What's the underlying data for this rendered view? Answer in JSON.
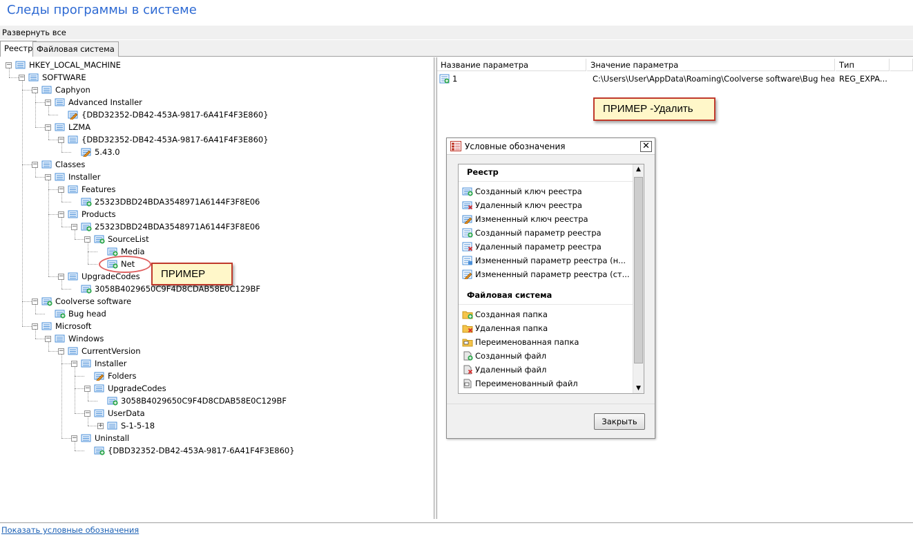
{
  "app": {
    "title": "Следы программы в системе",
    "menu": "Развернуть все",
    "tabs": [
      "Реестр",
      "Файловая система"
    ],
    "status_link": "Показать условные обозначения"
  },
  "tree": [
    {
      "label": "HKEY_LOCAL_MACHINE",
      "icon": "registry-key-icon"
    },
    {
      "label": "SOFTWARE",
      "icon": "registry-key-icon"
    },
    {
      "label": "Caphyon",
      "icon": "registry-key-icon"
    },
    {
      "label": "Advanced Installer",
      "icon": "registry-key-icon"
    },
    {
      "label": "{DBD32352-DB42-453A-9817-6A41F4F3E860}",
      "icon": "modified-registry-key-icon"
    },
    {
      "label": "LZMA",
      "icon": "registry-key-icon"
    },
    {
      "label": "{DBD32352-DB42-453A-9817-6A41F4F3E860}",
      "icon": "registry-key-icon"
    },
    {
      "label": "5.43.0",
      "icon": "modified-registry-key-icon"
    },
    {
      "label": "Classes",
      "icon": "registry-key-icon"
    },
    {
      "label": "Installer",
      "icon": "registry-key-icon"
    },
    {
      "label": "Features",
      "icon": "registry-key-icon"
    },
    {
      "label": "25323DBD24BDA3548971A6144F3F8E06",
      "icon": "created-registry-key-icon"
    },
    {
      "label": "Products",
      "icon": "registry-key-icon"
    },
    {
      "label": "25323DBD24BDA3548971A6144F3F8E06",
      "icon": "created-registry-key-icon"
    },
    {
      "label": "SourceList",
      "icon": "created-registry-key-icon"
    },
    {
      "label": "Media",
      "icon": "created-registry-key-icon"
    },
    {
      "label": "Net",
      "icon": "created-registry-key-icon"
    },
    {
      "label": "UpgradeCodes",
      "icon": "registry-key-icon"
    },
    {
      "label": "3058B4029650C9F4D8CDAB58E0C129BF",
      "icon": "created-registry-key-icon"
    },
    {
      "label": "Coolverse software",
      "icon": "created-registry-key-icon"
    },
    {
      "label": "Bug head",
      "icon": "created-registry-key-icon"
    },
    {
      "label": "Microsoft",
      "icon": "registry-key-icon"
    },
    {
      "label": "Windows",
      "icon": "registry-key-icon"
    },
    {
      "label": "CurrentVersion",
      "icon": "registry-key-icon"
    },
    {
      "label": "Installer",
      "icon": "registry-key-icon"
    },
    {
      "label": "Folders",
      "icon": "modified-registry-key-icon"
    },
    {
      "label": "UpgradeCodes",
      "icon": "registry-key-icon"
    },
    {
      "label": "3058B4029650C9F4D8CDAB58E0C129BF",
      "icon": "created-registry-key-icon"
    },
    {
      "label": "UserData",
      "icon": "registry-key-icon"
    },
    {
      "label": "S-1-5-18",
      "icon": "registry-key-icon"
    },
    {
      "label": "Uninstall",
      "icon": "registry-key-icon"
    },
    {
      "label": "{DBD32352-DB42-453A-9817-6A41F4F3E860}",
      "icon": "created-registry-key-icon"
    }
  ],
  "list": {
    "columns": [
      "Название параметра",
      "Значение параметра",
      "Тип"
    ],
    "rows": [
      {
        "name": "1",
        "value": "C:\\Users\\User\\AppData\\Roaming\\Coolverse software\\Bug head...",
        "type": "REG_EXPA..."
      }
    ]
  },
  "callouts": {
    "example": "ПРИМЕР",
    "example_delete": "ПРИМЕР -Удалить"
  },
  "legend": {
    "title": "Условные обозначения",
    "close_button": "Закрыть",
    "sections": [
      {
        "heading": "Реестр",
        "items": [
          {
            "label": "Созданный ключ реестра",
            "icon": "created-key-icon"
          },
          {
            "label": "Удаленный ключ реестра",
            "icon": "deleted-key-icon"
          },
          {
            "label": "Измененный ключ реестра",
            "icon": "modified-key-icon"
          },
          {
            "label": "Созданный параметр реестра",
            "icon": "created-value-icon"
          },
          {
            "label": "Удаленный параметр реестра",
            "icon": "deleted-value-icon"
          },
          {
            "label": "Измененный параметр реестра (н...",
            "icon": "modified-value-new-icon"
          },
          {
            "label": "Измененный параметр реестра (ст...",
            "icon": "modified-value-old-icon"
          }
        ]
      },
      {
        "heading": "Файловая система",
        "items": [
          {
            "label": "Созданная папка",
            "icon": "created-folder-icon"
          },
          {
            "label": "Удаленная папка",
            "icon": "deleted-folder-icon"
          },
          {
            "label": "Переименованная папка",
            "icon": "renamed-folder-icon"
          },
          {
            "label": "Созданный файл",
            "icon": "created-file-icon"
          },
          {
            "label": "Удаленный файл",
            "icon": "deleted-file-icon"
          },
          {
            "label": "Переименованный файл",
            "icon": "renamed-file-icon"
          }
        ]
      }
    ]
  },
  "colors": {
    "title": "#2e6ad3",
    "key_blue": "#4a8fd8",
    "created_green": "#2fa84f",
    "deleted_red": "#d62c2c",
    "modified_orange": "#e08a1e",
    "callout_bg": "#fff7c9",
    "callout_border": "#c0392b"
  }
}
